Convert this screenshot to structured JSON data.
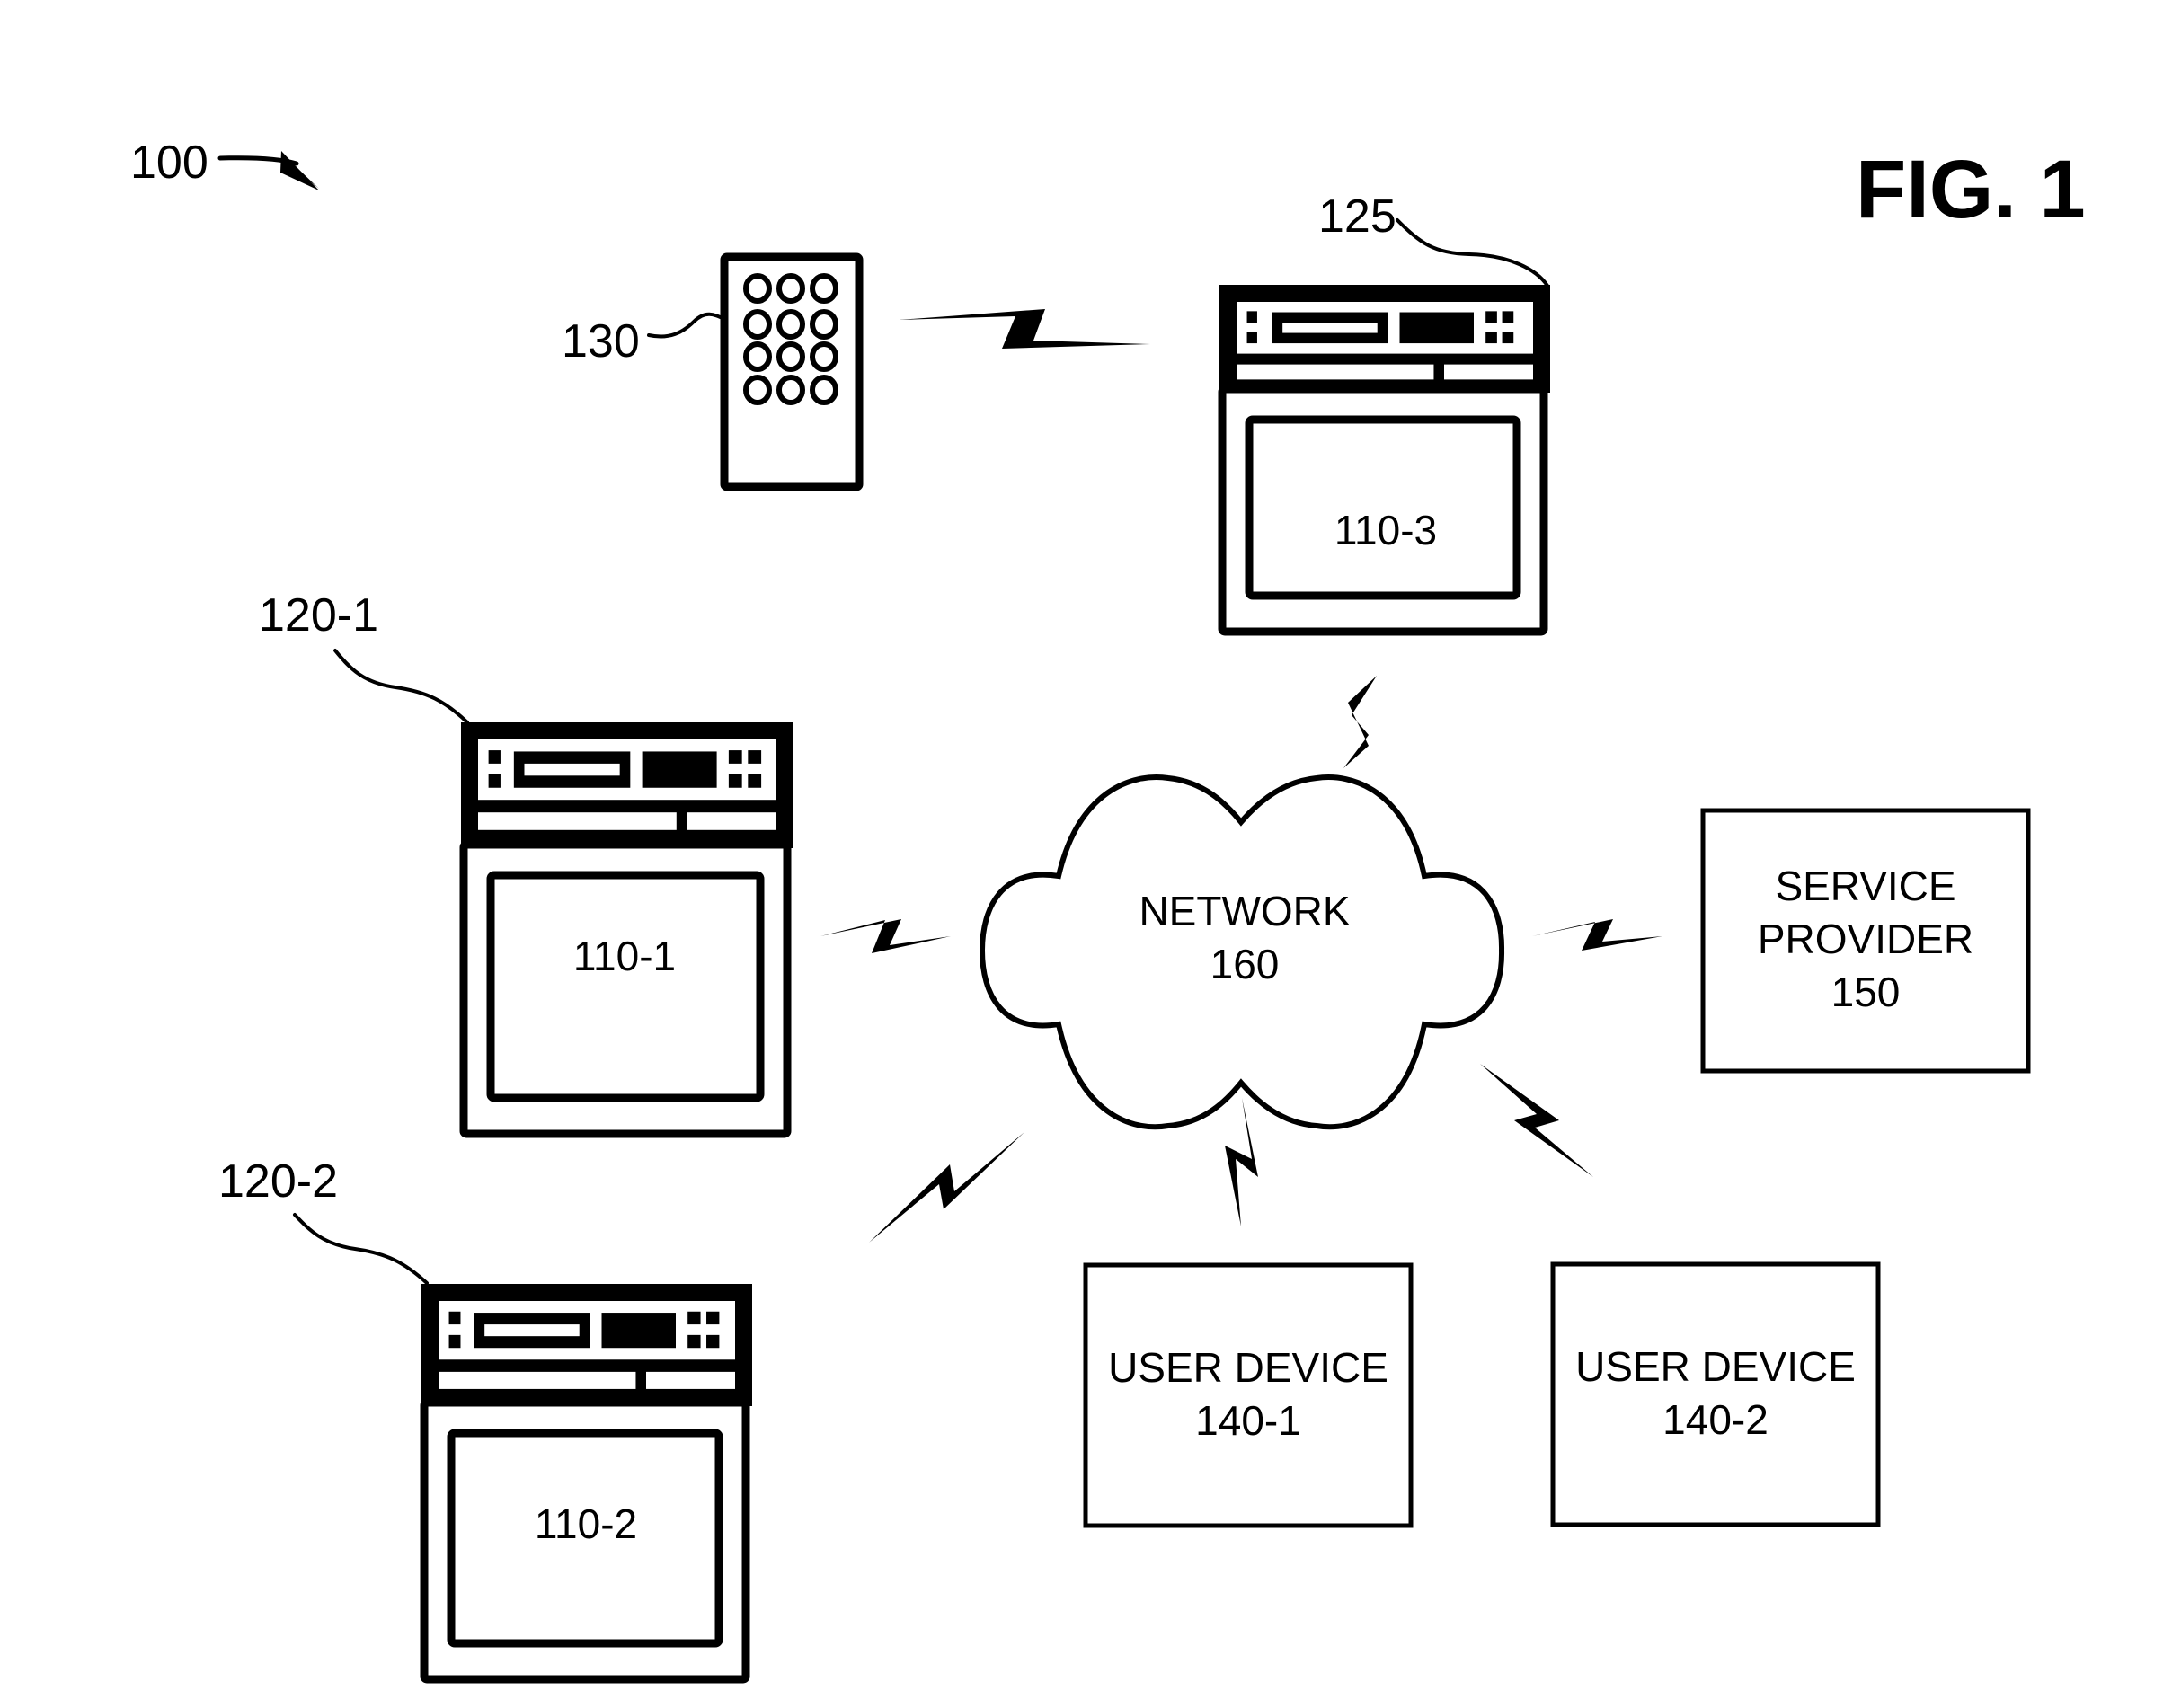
{
  "figure": {
    "title": "FIG. 1",
    "system_ref": "100"
  },
  "colors": {
    "stroke": "#000000",
    "background": "#ffffff"
  },
  "remote": {
    "ref": "130",
    "button_rows": 4,
    "button_cols": 3,
    "icon": "remote-control-icon"
  },
  "set_top_box_ref": "125",
  "devices": [
    {
      "id": "device-1",
      "ref": "120-1",
      "screen_label": "110-1",
      "icon": "tv-with-set-top-box-icon"
    },
    {
      "id": "device-2",
      "ref": "120-2",
      "screen_label": "110-2",
      "icon": "tv-with-set-top-box-icon"
    },
    {
      "id": "device-3",
      "ref": null,
      "screen_label": "110-3",
      "icon": "tv-with-set-top-box-icon"
    }
  ],
  "network": {
    "label": "NETWORK",
    "ref": "160",
    "icon": "cloud-icon"
  },
  "service_provider": {
    "line1": "SERVICE",
    "line2": "PROVIDER",
    "ref": "150"
  },
  "user_devices": [
    {
      "label": "USER DEVICE",
      "ref": "140-1"
    },
    {
      "label": "USER DEVICE",
      "ref": "140-2"
    }
  ],
  "links": [
    {
      "from": "130",
      "to": "110-3",
      "type": "wireless"
    },
    {
      "from": "110-3",
      "to": "160",
      "type": "wireless"
    },
    {
      "from": "110-1",
      "to": "160",
      "type": "wireless"
    },
    {
      "from": "110-2",
      "to": "160",
      "type": "wireless"
    },
    {
      "from": "160",
      "to": "150",
      "type": "wireless"
    },
    {
      "from": "160",
      "to": "140-1",
      "type": "wireless"
    },
    {
      "from": "160",
      "to": "140-2",
      "type": "wireless"
    }
  ]
}
